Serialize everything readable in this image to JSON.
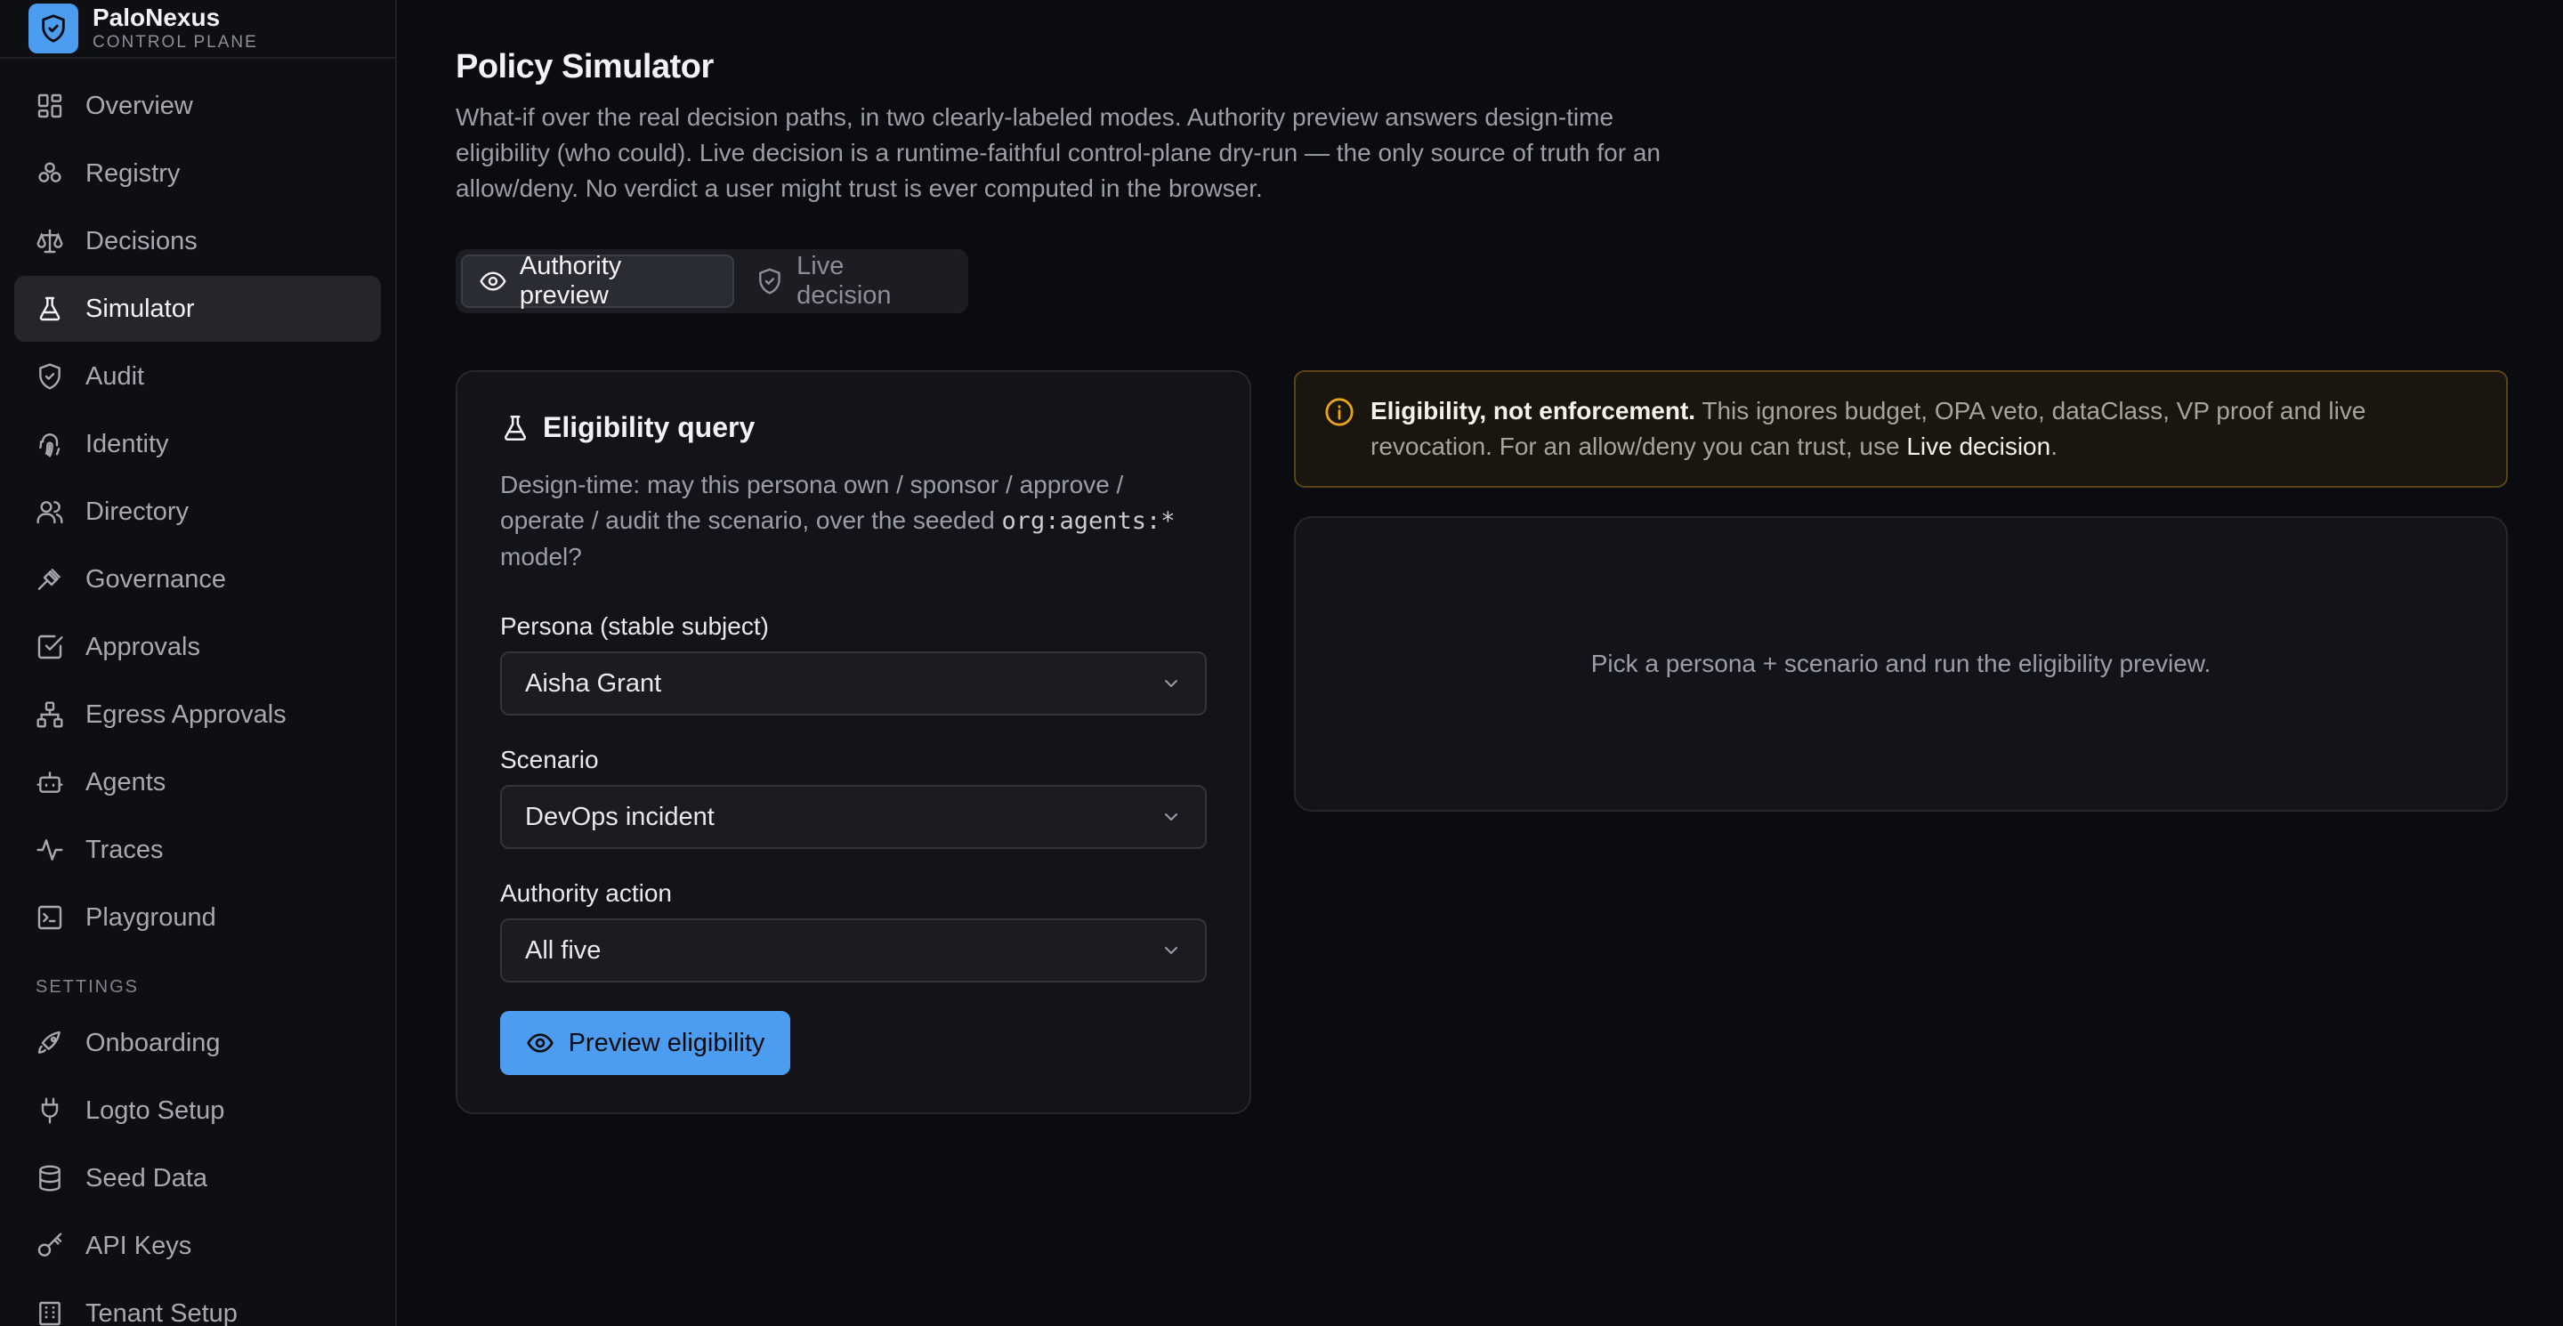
{
  "brand": {
    "name": "PaloNexus",
    "subtitle": "CONTROL PLANE"
  },
  "sidebar": {
    "items": [
      {
        "label": "Overview",
        "icon": "grid-icon"
      },
      {
        "label": "Registry",
        "icon": "network-icon"
      },
      {
        "label": "Decisions",
        "icon": "scale-icon"
      },
      {
        "label": "Simulator",
        "icon": "flask-icon",
        "active": true
      },
      {
        "label": "Audit",
        "icon": "shield-check-icon"
      },
      {
        "label": "Identity",
        "icon": "fingerprint-icon"
      },
      {
        "label": "Directory",
        "icon": "users-icon"
      },
      {
        "label": "Governance",
        "icon": "gavel-icon"
      },
      {
        "label": "Approvals",
        "icon": "check-square-icon"
      },
      {
        "label": "Egress Approvals",
        "icon": "sitemap-icon"
      },
      {
        "label": "Agents",
        "icon": "bot-icon"
      },
      {
        "label": "Traces",
        "icon": "activity-icon"
      },
      {
        "label": "Playground",
        "icon": "terminal-icon"
      }
    ],
    "settings_label": "SETTINGS",
    "settings_items": [
      {
        "label": "Onboarding",
        "icon": "rocket-icon"
      },
      {
        "label": "Logto Setup",
        "icon": "plug-icon"
      },
      {
        "label": "Seed Data",
        "icon": "database-icon"
      },
      {
        "label": "API Keys",
        "icon": "key-icon"
      },
      {
        "label": "Tenant Setup",
        "icon": "building-icon"
      }
    ]
  },
  "page": {
    "title": "Policy Simulator",
    "description": "What-if over the real decision paths, in two clearly-labeled modes. Authority preview answers design-time eligibility (who could). Live decision is a runtime-faithful control-plane dry-run — the only source of truth for an allow/deny. No verdict a user might trust is ever computed in the browser."
  },
  "modes": {
    "authority_preview": "Authority preview",
    "live_decision": "Live decision",
    "active": "authority_preview"
  },
  "query": {
    "title": "Eligibility query",
    "desc_prefix": "Design-time: may this persona own / sponsor / approve / operate / audit the scenario, over the seeded",
    "desc_code": "org:agents:*",
    "desc_suffix": "model?",
    "persona_label": "Persona (stable subject)",
    "persona_value": "Aisha Grant",
    "scenario_label": "Scenario",
    "scenario_value": "DevOps incident",
    "action_label": "Authority action",
    "action_value": "All five",
    "submit_label": "Preview eligibility"
  },
  "warning": {
    "title": "Eligibility, not enforcement.",
    "body": "This ignores budget, OPA veto, dataClass, VP proof and live revocation. For an allow/deny you can trust, use",
    "link": "Live decision",
    "end": "."
  },
  "result": {
    "empty_text": "Pick a persona + scenario and run the eligibility preview."
  },
  "colors": {
    "accent": "#4c9cf0",
    "warning": "#e8a317",
    "background": "#0b0c10"
  }
}
